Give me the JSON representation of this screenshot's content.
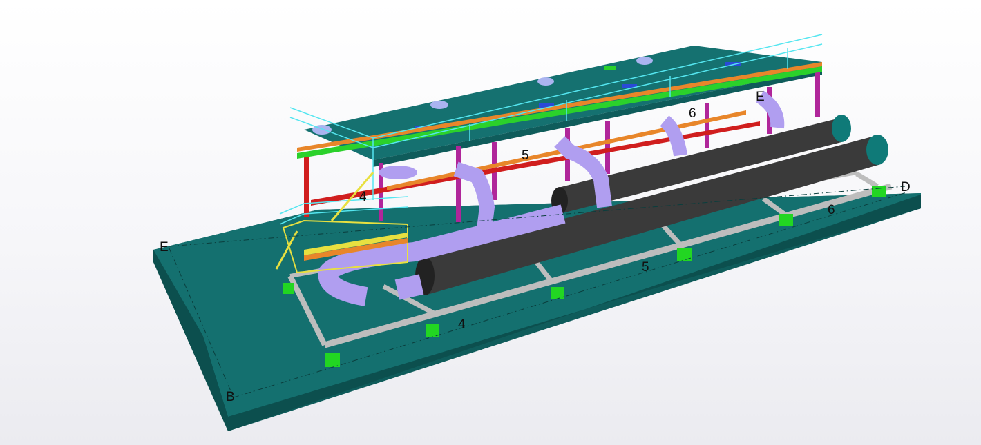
{
  "viewer": {
    "background": "#f4f4f7",
    "model": {
      "colors": {
        "slab_top": "#14706f",
        "slab_side": "#0f5c5b",
        "roof": "#157170",
        "steel_frame": "#c8c8c8",
        "pipe_purple": "#b09ef0",
        "pipe_black": "#3a3a3a",
        "column_magenta": "#b0269a",
        "column_red": "#d01e1e",
        "beam_green": "#2bd12b",
        "beam_orange": "#e8862a",
        "handrail_cyan": "#55e6f0",
        "handrail_yellow": "#e8e040",
        "support_green": "#22d622"
      }
    },
    "grid_labels": {
      "b_left_top": "E",
      "b_left_bottom": "B",
      "d_right_top": "E",
      "d_right_bottom": "D",
      "num_4_upper": "4",
      "num_4_lower": "4",
      "num_5_upper": "5",
      "num_5_lower": "5",
      "num_6_upper": "6",
      "num_6_lower": "6"
    }
  }
}
